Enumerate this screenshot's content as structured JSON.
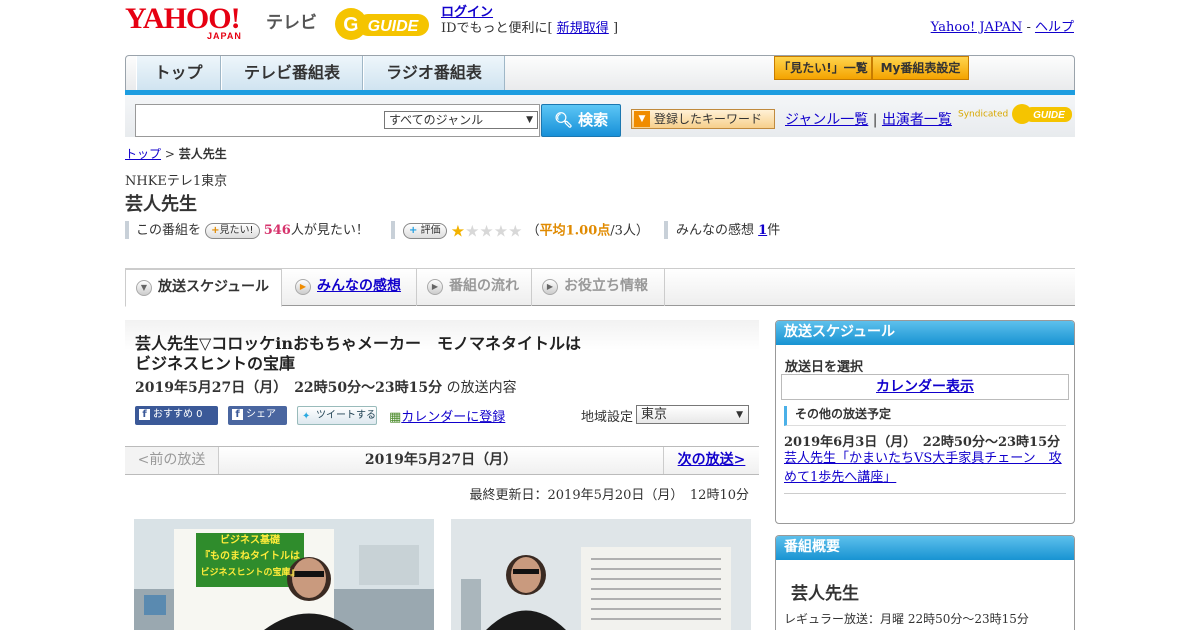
{
  "header": {
    "logo_text": "YAHOO!",
    "logo_sub": "JAPAN",
    "tv_label": "テレビ",
    "gguide_logo": "G GUIDE",
    "login": "ログイン",
    "login_desc": "IDでもっと便利に[",
    "register": "新規取得",
    "login_close": "]",
    "yahoo_japan": "Yahoo! JAPAN",
    "sep": "-",
    "help": "ヘルプ"
  },
  "nav": {
    "tabs": [
      {
        "label": "トップ"
      },
      {
        "label": "テレビ番組表"
      },
      {
        "label": "ラジオ番組表"
      }
    ],
    "watchlist": "「見たい!」一覧",
    "my_settings": "My番組表設定"
  },
  "search": {
    "placeholder": "",
    "genre": "すべてのジャンル",
    "button": "検索",
    "keyword_button": "登録したキーワード",
    "genre_list": "ジャンル一覧",
    "divider": "|",
    "performer_list": "出演者一覧",
    "syndicated": "Syndicated"
  },
  "breadcrumb": {
    "top": "トップ",
    "sep": ">",
    "current": "芸人先生"
  },
  "program": {
    "channel": "NHKEテレ1東京",
    "title": "芸人先生",
    "want_prefix": "この番組を",
    "want_button": "見たい!",
    "want_count": "546",
    "want_suffix": "人が見たい！",
    "rate_button": "評価",
    "rating_stars": 1,
    "rating_open": "（",
    "rating_avg": "平均1.00点",
    "rating_people": "/3人）",
    "reviews_label": "みんなの感想",
    "reviews_count": "1",
    "reviews_unit": "件"
  },
  "tabs": [
    {
      "label": "放送スケジュール"
    },
    {
      "label": "みんなの感想"
    },
    {
      "label": "番組の流れ"
    },
    {
      "label": "お役立ち情報"
    }
  ],
  "episode": {
    "title_line1": "芸人先生▽コロッケinおもちゃメーカー　モノマネタイトルは",
    "title_line2": "ビジネスヒントの宝庫",
    "date": "2019年5月27日（月）　22時50分～23時15分",
    "date_suffix": "の放送内容",
    "fb_recommend": "おすすめ 0",
    "fb_share": "シェア",
    "tweet": "ツイートする",
    "calendar": "カレンダーに登録",
    "region_label": "地域設定",
    "region": "東京",
    "prev": "<前の放送",
    "current_date": "2019年5月27日（月）",
    "next": "次の放送>",
    "updated": "最終更新日：2019年5月20日（月）　12時10分",
    "photo1_sign_line1": "ビジネス基礎",
    "photo1_sign_line2": "『ものまねタイトルは",
    "photo1_sign_line3": "ビジネスヒントの宝庫』"
  },
  "sidebar": {
    "schedule_title": "放送スケジュール",
    "select_date": "放送日を選択",
    "calendar": "カレンダー表示",
    "other_title": "その他の放送予定",
    "other_date": "2019年6月3日（月）　22時50分～23時15分",
    "other_link": "芸人先生「かまいたちVS大手家具チェーン　攻めて1歩先へ講座」",
    "summary_title": "番組概要",
    "summary_name": "芸人先生",
    "summary_regular": "レギュラー放送：月曜 22時50分～23時15分"
  },
  "colors": {
    "accent_blue": "#1e9de0",
    "brand_red": "#e60012",
    "rating_orange": "#e08a00",
    "want_count": "#d6336c"
  }
}
